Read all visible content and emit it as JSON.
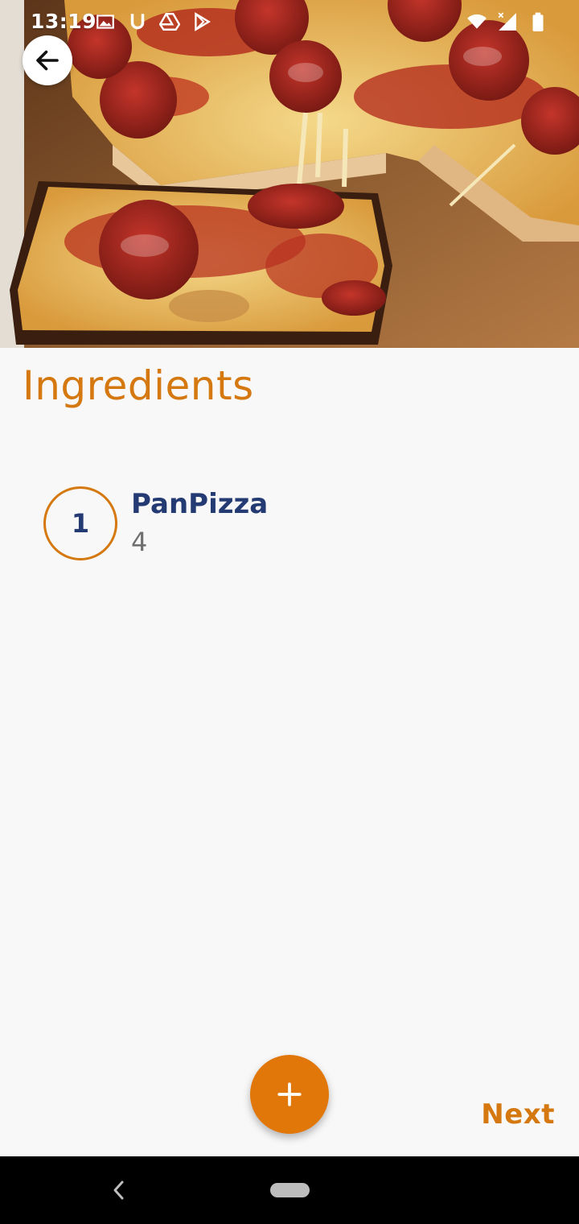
{
  "status_bar": {
    "time": "13:19",
    "left_icons": [
      "image-notification-icon",
      "u-app-icon",
      "drive-icon",
      "play-store-icon"
    ],
    "right_icons": [
      "wifi-icon",
      "signal-icon",
      "battery-icon"
    ]
  },
  "header": {
    "back_icon": "arrow-left-icon",
    "hero_image": "pan-pizza-photo"
  },
  "page": {
    "title": "Ingredients"
  },
  "ingredients": [
    {
      "index": "1",
      "name": "PanPizza",
      "quantity": "4"
    }
  ],
  "actions": {
    "add_icon": "plus-icon",
    "next_label": "Next"
  },
  "colors": {
    "accent": "#d4780f",
    "fab": "#e07708",
    "primary_text": "#243a73",
    "secondary_text": "#6f6f6f",
    "background": "#f8f8f8"
  }
}
